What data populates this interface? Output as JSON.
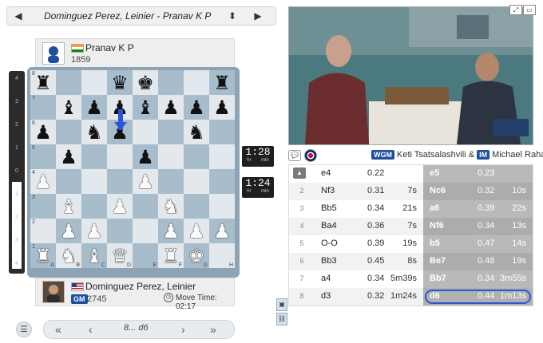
{
  "game": {
    "title": "Dominguez Perez, Leinier - Pranav K P",
    "prev_icon": "triangle-left-icon",
    "next_icon": "triangle-right-icon",
    "sort_icon": "updown-icon"
  },
  "top_player": {
    "name": "Pranav K P",
    "rating": "1859",
    "flag": "india-flag-icon"
  },
  "bottom_player": {
    "name": "Dominguez Perez, Leinier",
    "title": "GM",
    "rating": "2745",
    "flag": "usa-flag-icon",
    "move_time_label": "Move Time: 02:17"
  },
  "clocks": {
    "top": {
      "time": "1:28",
      "hr": "hr",
      "min": "min"
    },
    "bottom": {
      "time": "1:24",
      "hr": "hr",
      "min": "min"
    }
  },
  "eval_ticks": [
    "4",
    "3",
    "2",
    "1",
    "0",
    "1",
    "2",
    "3",
    "4"
  ],
  "eval_white_fraction": 0.45,
  "board": {
    "files": [
      "A",
      "B",
      "C",
      "D",
      "E",
      "F",
      "G",
      "H"
    ],
    "ranks": [
      "8",
      "7",
      "6",
      "5",
      "4",
      "3",
      "2",
      "1"
    ],
    "rows": [
      [
        "br",
        "",
        "",
        "bq",
        "bk",
        "",
        "",
        "br"
      ],
      [
        "",
        "bb",
        "bp",
        "bp",
        "bb",
        "bp",
        "bp",
        "bp"
      ],
      [
        "bp",
        "",
        "bn",
        "bp",
        "",
        "",
        "bn",
        ""
      ],
      [
        "",
        "bp",
        "",
        "",
        "bp",
        "",
        "",
        ""
      ],
      [
        "wp",
        "",
        "",
        "",
        "wp",
        "",
        "",
        ""
      ],
      [
        "",
        "wb",
        "",
        "wp",
        "",
        "wn",
        "",
        ""
      ],
      [
        "",
        "wp",
        "wp",
        "",
        "",
        "wp",
        "wp",
        "wp"
      ],
      [
        "wr",
        "wn",
        "wb",
        "wq",
        "",
        "wr",
        "wk",
        ""
      ]
    ]
  },
  "bottom_nav": {
    "menu_icon": "hamburger-icon",
    "first_icon": "double-chevron-left-icon",
    "prev_icon": "chevron-left-icon",
    "current_move": "8... d6",
    "next_icon": "chevron-right-icon",
    "last_icon": "double-chevron-right-icon"
  },
  "commentators": {
    "wgm": "WGM",
    "name1": "Keti Tsatsalashvili",
    "amp": "&",
    "im": "IM",
    "name2": "Michael Rahal"
  },
  "moves": [
    {
      "num": "1",
      "white": "e4",
      "weval": "0.22",
      "wtime": "",
      "black": "e5",
      "beval": "0.23",
      "btime": ""
    },
    {
      "num": "2",
      "white": "Nf3",
      "weval": "0.31",
      "wtime": "7s",
      "black": "Nc6",
      "beval": "0.32",
      "btime": "10s"
    },
    {
      "num": "3",
      "white": "Bb5",
      "weval": "0.34",
      "wtime": "21s",
      "black": "a6",
      "beval": "0.39",
      "btime": "22s"
    },
    {
      "num": "4",
      "white": "Ba4",
      "weval": "0.36",
      "wtime": "7s",
      "black": "Nf6",
      "beval": "0.34",
      "btime": "13s"
    },
    {
      "num": "5",
      "white": "O-O",
      "weval": "0.39",
      "wtime": "19s",
      "black": "b5",
      "beval": "0.47",
      "btime": "14s"
    },
    {
      "num": "6",
      "white": "Bb3",
      "weval": "0.45",
      "wtime": "8s",
      "black": "Be7",
      "beval": "0.48",
      "btime": "19s"
    },
    {
      "num": "7",
      "white": "a4",
      "weval": "0.34",
      "wtime": "5m39s",
      "black": "Bb7",
      "beval": "0.34",
      "btime": "3m55s"
    },
    {
      "num": "8",
      "white": "d3",
      "weval": "0.32",
      "wtime": "1m24s",
      "black": "d6",
      "beval": "0.44",
      "btime": "1m13s"
    }
  ]
}
